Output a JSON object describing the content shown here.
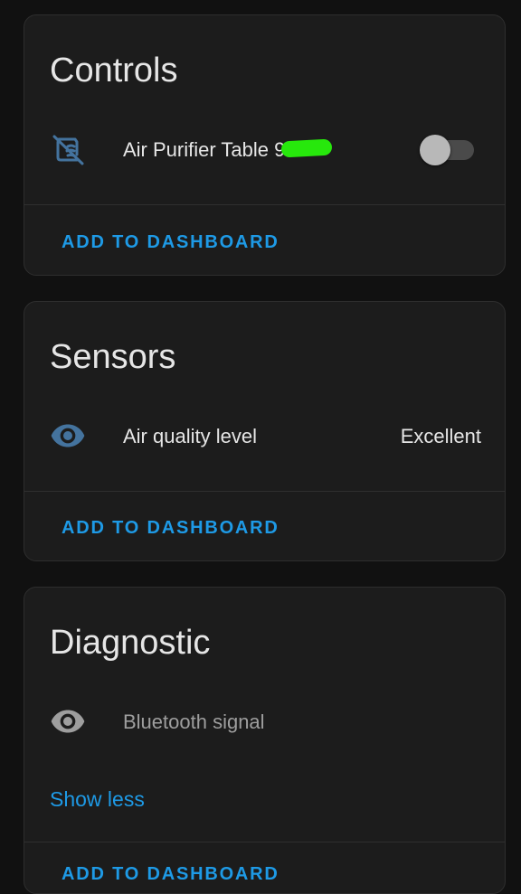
{
  "controls": {
    "title": "Controls",
    "entity": {
      "icon": "air-purifier-off-icon",
      "label": "Air Purifier Table 9",
      "state": "off"
    },
    "add_label": "ADD TO DASHBOARD"
  },
  "sensors": {
    "title": "Sensors",
    "entity": {
      "icon": "eye-icon",
      "label": "Air quality level",
      "value": "Excellent"
    },
    "add_label": "ADD TO DASHBOARD"
  },
  "diagnostic": {
    "title": "Diagnostic",
    "entity": {
      "icon": "eye-icon",
      "label": "Bluetooth signal"
    },
    "show_less": "Show less",
    "add_label": "ADD TO DASHBOARD"
  },
  "colors": {
    "accent": "#1e9ae6",
    "icon_active": "#44739e",
    "icon_inactive": "#9e9e9e",
    "redaction": "#27e80c"
  }
}
